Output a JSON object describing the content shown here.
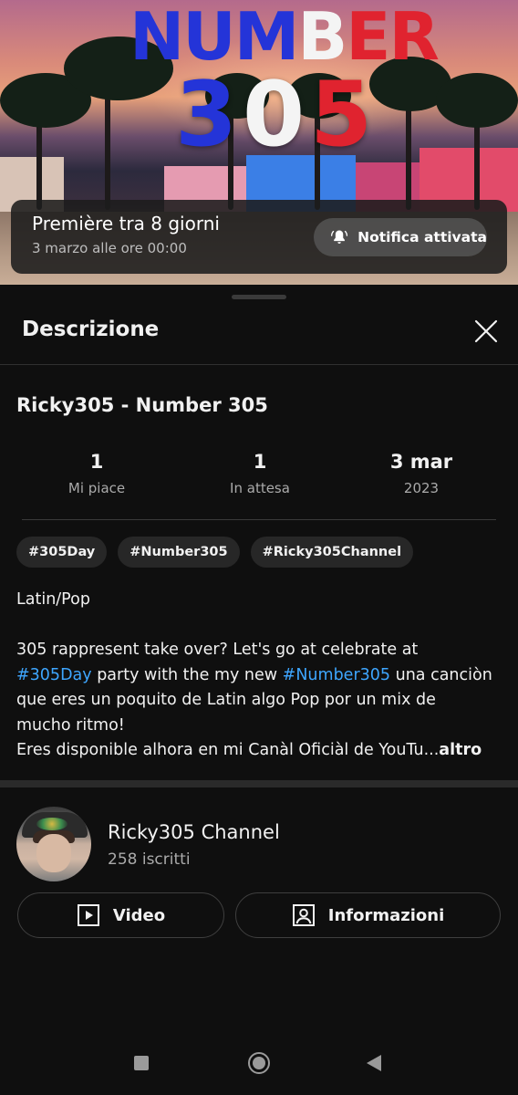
{
  "thumbnail": {
    "title_parts": [
      {
        "text": "NUM",
        "color": "#2434d8"
      },
      {
        "text": "B",
        "color": "#f4f4f4"
      },
      {
        "text": "ER",
        "color": "#e0232f"
      }
    ],
    "digits": [
      {
        "text": "3",
        "color": "#2434d8"
      },
      {
        "text": "0",
        "color": "#f4f4f4"
      },
      {
        "text": "5",
        "color": "#e0232f"
      }
    ]
  },
  "premiere": {
    "title": "Première tra 8 giorni",
    "subtitle": "3 marzo alle ore 00:00",
    "notify_label": "Notifica attivata",
    "notify_icon": "bell-ringing-icon"
  },
  "sheet": {
    "title": "Descrizione",
    "close_icon": "close-icon"
  },
  "video": {
    "title": "Ricky305 - Number 305",
    "stats": [
      {
        "value": "1",
        "label": "Mi piace"
      },
      {
        "value": "1",
        "label": "In attesa"
      },
      {
        "value": "3 mar",
        "label": "2023"
      }
    ],
    "hashtags": [
      "#305Day",
      "#Number305",
      "#Ricky305Channel"
    ]
  },
  "description": {
    "genre": "Latin/Pop",
    "line1": "305 rappresent take over? Let's go at celebrate at",
    "line2_tag1": "#305Day",
    "line2_mid": " party with the my new ",
    "line2_tag2": "#Number305",
    "line2_end": " una canciòn",
    "line3": "que eres un poquito de Latin algo Pop por un mix de",
    "line4": "mucho ritmo!",
    "line5": "Eres disponible alhora en mi Canàl Oficiàl de YouTu...",
    "more_label": "altro"
  },
  "channel": {
    "name": "Ricky305 Channel",
    "subscribers": "258 iscritti",
    "video_button": "Video",
    "video_icon": "play-box-icon",
    "info_button": "Informazioni",
    "info_icon": "person-box-icon"
  },
  "colors": {
    "background": "#0f0f0f",
    "hashtag": "#3ea6ff",
    "chip": "#272727"
  }
}
